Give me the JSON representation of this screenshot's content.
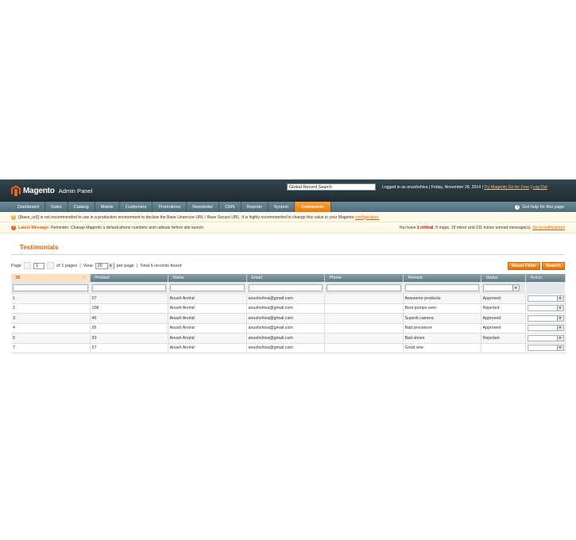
{
  "header": {
    "logo_text": "Magento",
    "logo_sub": "Admin Panel",
    "global_search": "Global Record Search",
    "logged_in": "Logged in as anushshiva",
    "date": "Friday, November 28, 2014",
    "try_link": "Try Magento Go for Free",
    "logout": "Log Out"
  },
  "nav": {
    "items": [
      "Dashboard",
      "Sales",
      "Catalog",
      "Mobile",
      "Customers",
      "Promotions",
      "Newsletter",
      "CMS",
      "Reports",
      "System",
      "Comments"
    ],
    "active": "Comments",
    "help": "Get help for this page"
  },
  "notices": {
    "base_url_text": "{{base_url}} is not recommended to use in a production environment to declare the Base Unsecure URL / Base Secure URL. It is highly recommended to change this value in your Magento",
    "base_url_link": "configuration.",
    "latest_label": "Latest Message:",
    "latest_text": "Reminder: Change Magento`s default phone numbers and callouts before site launch",
    "counts_prefix": "You have",
    "critical": "1 critical",
    "rest": ", 5 major, 19 minor and 211 notice unread message(s).",
    "goto_link": "Go to notifications"
  },
  "page": {
    "title": "Testimonials"
  },
  "pager": {
    "page_label": "Page",
    "page_value": "1",
    "of_pages": "of 1 pages",
    "view_label": "View",
    "view_value": "20",
    "per_page": "per page",
    "total": "Total 6 records found",
    "reset_filter": "Reset Filter",
    "search": "Search"
  },
  "grid": {
    "columns": [
      "ID",
      "Product",
      "Name",
      "Email",
      "Phone",
      "Remark",
      "Status",
      "Action"
    ],
    "rows": [
      {
        "id": "1",
        "product": "27",
        "name": "Anush Arvind",
        "email": "anushshiva@gmail.com",
        "phone": "",
        "remark": "Awesome products",
        "status": "Approved"
      },
      {
        "id": "2",
        "product": "108",
        "name": "Anush Arvind",
        "email": "anushshiva@gmail.com",
        "phone": "",
        "remark": "Best pumps ever",
        "status": "Rejected"
      },
      {
        "id": "3",
        "product": "46",
        "name": "Anush Arvind",
        "email": "anushshiva@gmail.com",
        "phone": "",
        "remark": "Superb camera",
        "status": "Approved"
      },
      {
        "id": "4",
        "product": "26",
        "name": "Anush Arvind",
        "email": "anushshiva@gmail.com",
        "phone": "",
        "remark": "Bad processor",
        "status": "Approved"
      },
      {
        "id": "5",
        "product": "93",
        "name": "Anush Arvind",
        "email": "anushshiva@gmail.com",
        "phone": "",
        "remark": "Bad shoes",
        "status": "Rejected"
      },
      {
        "id": "7",
        "product": "27",
        "name": "Anush Arvind",
        "email": "anushshiva@gmail.com",
        "phone": "",
        "remark": "Good one",
        "status": ""
      }
    ]
  },
  "colors": {
    "header_bg": "#2b3a40",
    "nav_bg": "#5a7787",
    "accent": "#eb7a00",
    "title": "#eb5e00"
  }
}
